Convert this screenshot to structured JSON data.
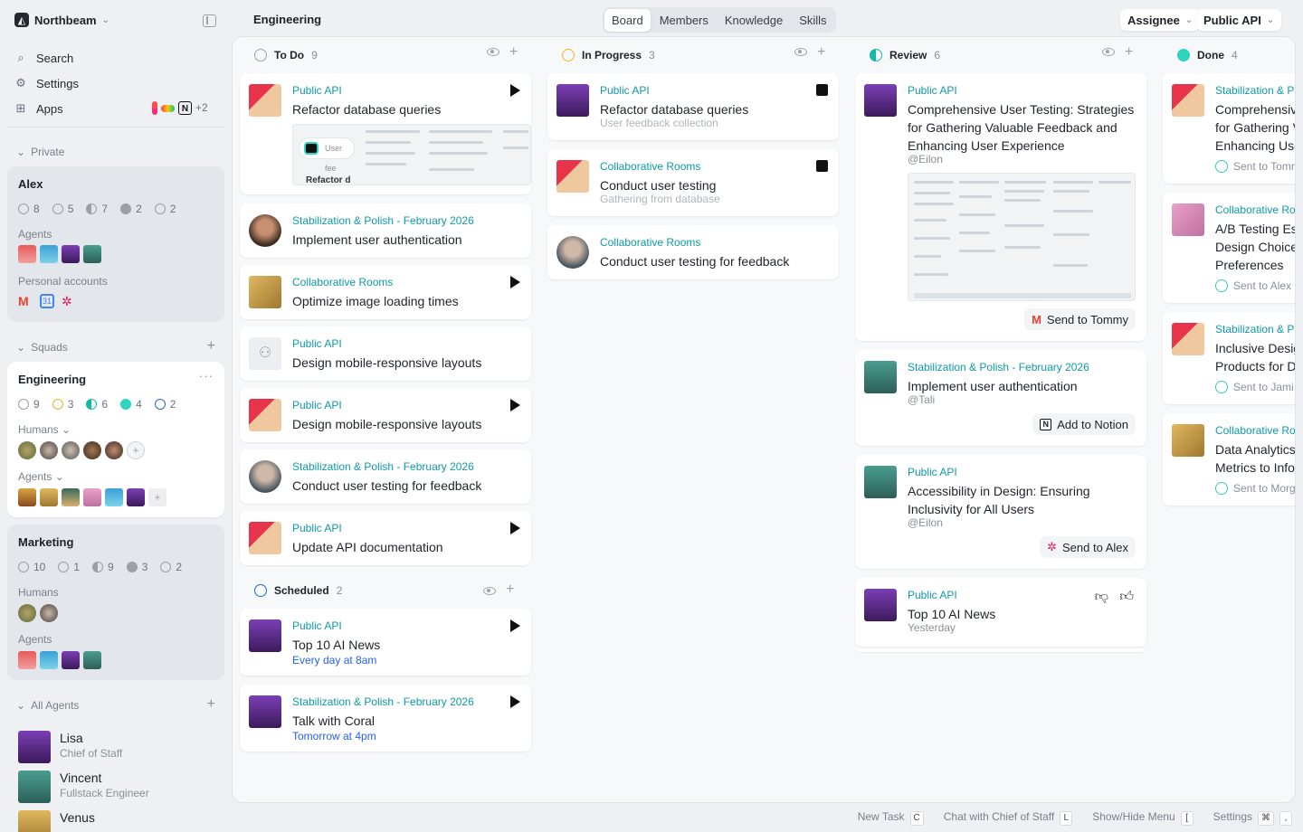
{
  "workspace": {
    "name": "Northbeam"
  },
  "nav": {
    "search": "Search",
    "settings": "Settings",
    "apps": "Apps",
    "apps_more": "+2"
  },
  "private": {
    "label": "Private",
    "user": "Alex",
    "stats": [
      "8",
      "5",
      "7",
      "2",
      "2"
    ],
    "agents_label": "Agents",
    "personal_label": "Personal accounts"
  },
  "squads": {
    "label": "Squads",
    "engineering": {
      "name": "Engineering",
      "stats": [
        "9",
        "3",
        "6",
        "4",
        "2"
      ],
      "humans_label": "Humans",
      "agents_label": "Agents"
    },
    "marketing": {
      "name": "Marketing",
      "stats": [
        "10",
        "1",
        "9",
        "3",
        "2"
      ],
      "humans_label": "Humans",
      "agents_label": "Agents"
    }
  },
  "all_agents": {
    "label": "All Agents",
    "items": [
      {
        "name": "Lisa",
        "role": "Chief of Staff"
      },
      {
        "name": "Vincent",
        "role": "Fullstack Engineer"
      },
      {
        "name": "Venus",
        "role": ""
      }
    ]
  },
  "header": {
    "title": "Engineering",
    "tabs": [
      "Board",
      "Members",
      "Knowledge",
      "Skills"
    ],
    "assignee": "Assignee",
    "project": "Public API"
  },
  "columns": {
    "todo": {
      "title": "To Do",
      "count": "9"
    },
    "inprogress": {
      "title": "In Progress",
      "count": "3"
    },
    "review": {
      "title": "Review",
      "count": "6"
    },
    "done": {
      "title": "Done",
      "count": "4"
    },
    "scheduled": {
      "title": "Scheduled",
      "count": "2"
    }
  },
  "todo_cards": [
    {
      "project": "Public API",
      "title": "Refactor database queries"
    },
    {
      "project": "Stabilization & Polish - February 2026",
      "title": "Implement user authentication"
    },
    {
      "project": "Collaborative Rooms",
      "title": "Optimize image loading times"
    },
    {
      "project": "Public API",
      "title": "Design mobile-responsive layouts"
    },
    {
      "project": "Public API",
      "title": "Design mobile-responsive layouts"
    },
    {
      "project": "Stabilization & Polish - February 2026",
      "title": "Conduct user testing for feedback"
    },
    {
      "project": "Public API",
      "title": "Update API documentation"
    }
  ],
  "todo_preview": {
    "chip": "User fee",
    "heading": "Refactor d"
  },
  "scheduled_cards": [
    {
      "project": "Public API",
      "title": "Top 10 AI News",
      "when": "Every day at 8am"
    },
    {
      "project": "Stabilization & Polish - February 2026",
      "title": "Talk with Coral",
      "when": "Tomorrow at 4pm"
    }
  ],
  "inprogress_cards": [
    {
      "project": "Public API",
      "title": "Refactor database queries",
      "sub": "User feedback collection"
    },
    {
      "project": "Collaborative Rooms",
      "title": "Conduct user testing",
      "sub": "Gathering from database"
    },
    {
      "project": "Collaborative Rooms",
      "title": "Conduct user testing for feedback",
      "sub": ""
    }
  ],
  "review_cards": [
    {
      "project": "Public API",
      "title_l1": "Comprehensive User Testing: Strategies",
      "title_l2": "for Gathering Valuable Feedback and",
      "title_l3": "Enhancing User Experience",
      "mention": "@Eilon",
      "action": "Send to Tommy"
    },
    {
      "project": "Stabilization & Polish - February 2026",
      "title": "Implement user authentication",
      "mention": "@Tali",
      "action": "Add to Notion"
    },
    {
      "project": "Public API",
      "title_l1": "Accessibility in Design: Ensuring",
      "title_l2": "Inclusivity for All Users",
      "mention": "@Eilon",
      "action": "Send to Alex"
    },
    {
      "project": "Public API",
      "title": "Top 10 AI News",
      "sub": "Yesterday"
    }
  ],
  "done_cards": [
    {
      "project": "Stabilization & P",
      "l1": "Comprehensiv",
      "l2": "for Gathering V",
      "l3": "Enhancing Use",
      "sent": "Sent to Tomm"
    },
    {
      "project": "Collaborative Ro",
      "l1": "A/B Testing Es",
      "l2": "Design Choice",
      "l3": "Preferences",
      "sent": "Sent to Alex"
    },
    {
      "project": "Stabilization & P",
      "l1": "Inclusive Desig",
      "l2": "Products for D",
      "sent": "Sent to Jami"
    },
    {
      "project": "Collaborative Ro",
      "l1": "Data Analytics",
      "l2": "Metrics to Info",
      "sent": "Sent to Morg"
    }
  ],
  "footer": {
    "new_task": "New Task",
    "new_task_key": "C",
    "chat": "Chat with Chief of Staff",
    "chat_key": "L",
    "menu": "Show/Hide Menu",
    "menu_key": "[",
    "settings": "Settings",
    "settings_key1": "⌘",
    "settings_key2": ","
  },
  "colors": {
    "accent": "#0e9aa7",
    "schedule": "#2563eb",
    "inprogress": "#f0b429",
    "review": "#14b8a6",
    "done": "#2dd4bf"
  }
}
